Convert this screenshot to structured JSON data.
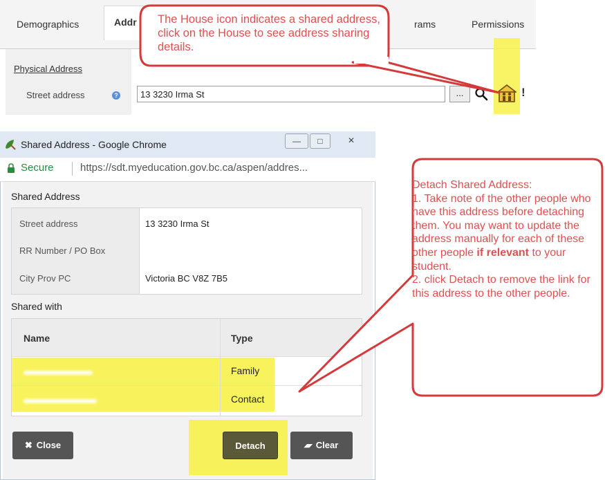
{
  "tabs": {
    "items": [
      {
        "label": "Demographics"
      },
      {
        "label": "Addr"
      },
      {
        "label": "rams"
      },
      {
        "label": "Permissions"
      }
    ]
  },
  "address_form": {
    "section_label": "Physical Address",
    "street_label": "Street address",
    "help_glyph": "?",
    "street_value": "13 3230 Irma St",
    "dots_label": "...",
    "trailing_mark": "!"
  },
  "callout_house": {
    "text": "The House icon indicates a shared address, click on the House to see address sharing details."
  },
  "window": {
    "title": "Shared Address - Google Chrome",
    "secure_label": "Secure",
    "url": "https://sdt.myeducation.gov.bc.ca/aspen/addres...",
    "min_glyph": "—",
    "max_glyph": "□",
    "close_glyph": "✕"
  },
  "shared_address": {
    "title": "Shared Address",
    "rows": [
      {
        "label": "Street address",
        "value": "13 3230 Irma St"
      },
      {
        "label": "RR Number / PO Box",
        "value": ""
      },
      {
        "label": "City Prov PC",
        "value": "Victoria BC V8Z 7B5"
      }
    ]
  },
  "shared_with": {
    "title": "Shared with",
    "headers": {
      "name": "Name",
      "type": "Type"
    },
    "rows": [
      {
        "type": "Family"
      },
      {
        "type": "Contact"
      }
    ]
  },
  "buttons": {
    "close": "Close",
    "detach": "Detach",
    "clear": "Clear"
  },
  "callout_detach": {
    "line1": "Detach Shared Address:",
    "line2_pre": "1. Take note of the other people who have this address before detaching them. You may want to update the address manually for each of these other people ",
    "line2_bold": "if relevant",
    "line2_post": " to your student.",
    "line3": "2. click Detach to remove the link for this address to the other people."
  },
  "colors": {
    "highlight": "#f7f24a",
    "callout_text": "#e05050",
    "callout_border": "#d53a3a",
    "secure_green": "#2b8a3e",
    "button_dark": "#555555"
  }
}
